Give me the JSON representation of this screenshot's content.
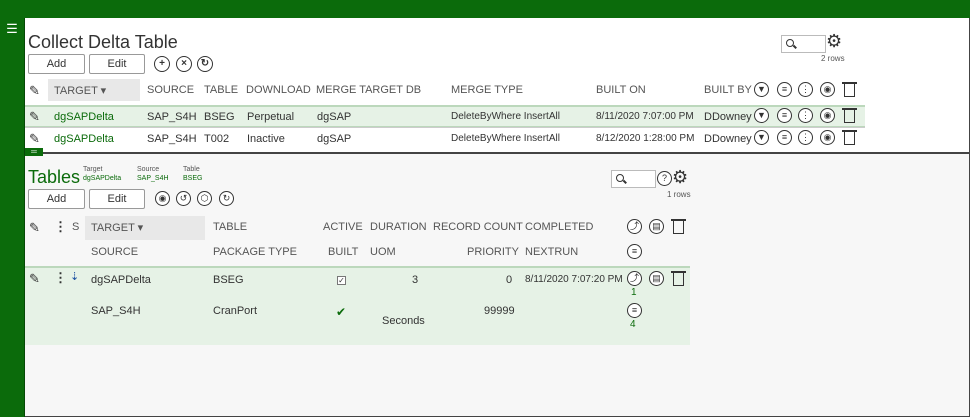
{
  "app": {
    "menu_icon": "hamburger-icon"
  },
  "collect": {
    "title": "Collect Delta Table",
    "add_label": "Add",
    "edit_label": "Edit",
    "rows_count": "2 rows",
    "search_placeholder": "",
    "columns": [
      "TARGET ▾",
      "SOURCE",
      "TABLE",
      "DOWNLOAD",
      "MERGE TARGET DB",
      "MERGE TYPE",
      "BUILT ON",
      "BUILT BY"
    ],
    "rows": [
      {
        "target": "dgSAPDelta",
        "source": "SAP_S4H",
        "table": "BSEG",
        "download": "Perpetual",
        "merge_db": "dgSAP",
        "merge_type": "DeleteByWhere InsertAll",
        "built_on": "8/11/2020 7:07:00 PM",
        "built_by": "DDowney"
      },
      {
        "target": "dgSAPDelta",
        "source": "SAP_S4H",
        "table": "T002",
        "download": "Inactive",
        "merge_db": "dgSAP",
        "merge_type": "DeleteByWhere InsertAll",
        "built_on": "8/12/2020 1:28:00 PM",
        "built_by": "DDowney"
      }
    ]
  },
  "tables": {
    "title": "Tables",
    "ctx_target_label": "Target",
    "ctx_target_value": "dgSAPDelta",
    "ctx_source_label": "Source",
    "ctx_source_value": "SAP_S4H",
    "ctx_table_label": "Table",
    "ctx_table_value": "BSEG",
    "add_label": "Add",
    "edit_label": "Edit",
    "rows_count": "1 rows",
    "help_glyph": "?",
    "headers_row1": {
      "s": "S",
      "target": "TARGET ▾",
      "table": "TABLE",
      "active": "ACTIVE",
      "duration": "DURATION",
      "record_count": "RECORD COUNT",
      "completed": "COMPLETED"
    },
    "headers_row2": {
      "source": "SOURCE",
      "package_type": "PACKAGE TYPE",
      "built": "BUILT",
      "uom": "UOM",
      "priority": "PRIORITY",
      "nextrun": "NEXTRUN"
    },
    "row": {
      "target": "dgSAPDelta",
      "table": "BSEG",
      "active_check": "✓",
      "duration": "3",
      "record_count": "0",
      "completed": "8/11/2020 7:07:20 PM",
      "source": "SAP_S4H",
      "package_type": "CranPort",
      "built_check": "✔",
      "uom": "Seconds",
      "priority": "99999",
      "badge1": "1",
      "badge2": "4"
    }
  }
}
